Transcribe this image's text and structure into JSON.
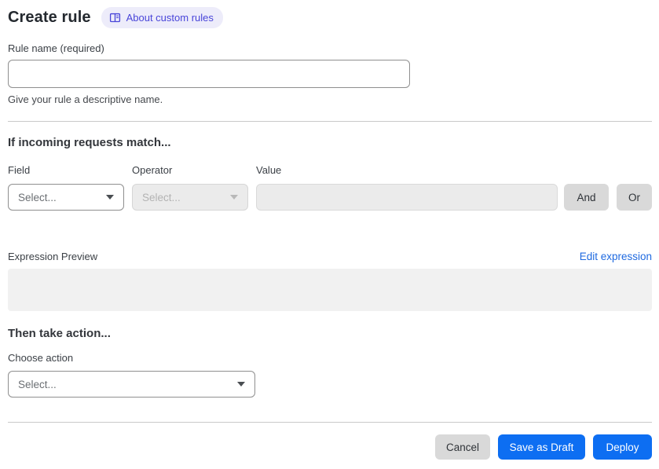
{
  "header": {
    "title": "Create rule",
    "about_link": "About custom rules"
  },
  "rule_name": {
    "label": "Rule name (required)",
    "value": "",
    "helper": "Give your rule a descriptive name."
  },
  "match_section": {
    "heading": "If incoming requests match...",
    "field": {
      "label": "Field",
      "placeholder": "Select..."
    },
    "operator": {
      "label": "Operator",
      "placeholder": "Select..."
    },
    "value": {
      "label": "Value",
      "value": ""
    },
    "and_button": "And",
    "or_button": "Or",
    "expression_preview_label": "Expression Preview",
    "edit_expression_link": "Edit expression",
    "expression_value": ""
  },
  "action_section": {
    "heading": "Then take action...",
    "choose_action_label": "Choose action",
    "placeholder": "Select..."
  },
  "footer": {
    "cancel": "Cancel",
    "save_draft": "Save as Draft",
    "deploy": "Deploy"
  },
  "colors": {
    "primary_blue": "#0d6ef2",
    "link_blue": "#1f6ae0",
    "badge_bg": "#edecfa",
    "badge_text": "#4945d9",
    "disabled_bg": "#ebebeb",
    "gray_button": "#d9d9d9",
    "preview_box_bg": "#f1f1f1"
  }
}
